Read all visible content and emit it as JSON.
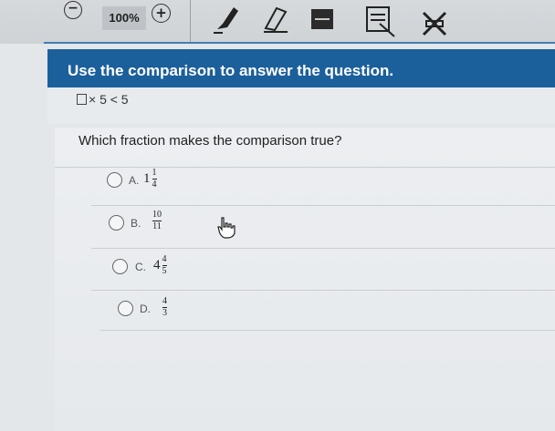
{
  "toolbar": {
    "zoom_out_symbol": "−",
    "zoom_level": "100%",
    "zoom_in_symbol": "+",
    "tools": [
      "pencil-icon",
      "eraser-icon",
      "highlighter-icon",
      "answer-masking-icon",
      "line-reader-icon"
    ]
  },
  "question": {
    "title": "Use the comparison to answer the question.",
    "comparison_text": "× 5 < 5",
    "prompt": "Which fraction makes the comparison true?"
  },
  "options": [
    {
      "letter": "A.",
      "whole": "1",
      "numerator": "1",
      "denominator": "4"
    },
    {
      "letter": "B.",
      "whole": "",
      "numerator": "10",
      "denominator": "11"
    },
    {
      "letter": "C.",
      "whole": "4",
      "numerator": "4",
      "denominator": "5"
    },
    {
      "letter": "D.",
      "whole": "",
      "numerator": "4",
      "denominator": "3"
    }
  ],
  "colors": {
    "header_blue": "#1b5f9b",
    "toolbar_gray": "#d3d6d9",
    "accent_line": "#3f7fb3"
  }
}
